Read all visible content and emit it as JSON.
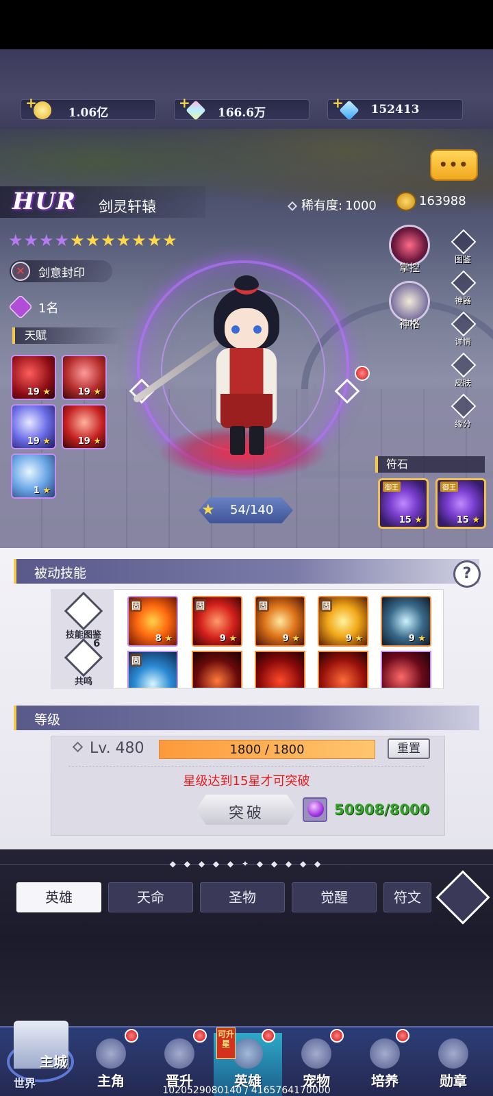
{
  "currencies": [
    {
      "value": "1.06亿",
      "icon": "gold-coin-icon"
    },
    {
      "value": "166.6万",
      "icon": "rainbow-crystal-icon"
    },
    {
      "value": "152413",
      "icon": "blue-diamond-icon"
    }
  ],
  "hero": {
    "grade": "HUR",
    "name": "剑灵轩辕",
    "rarity_label": "稀有度:",
    "rarity_value": "1000",
    "power": "163988",
    "stars": {
      "purple": 4,
      "gold": 7
    },
    "tag": "剑意封印",
    "rank": "1名",
    "xp": "54/140"
  },
  "talent": {
    "label": "天赋",
    "slots": [
      {
        "level": "19"
      },
      {
        "level": "19"
      },
      {
        "level": "19"
      },
      {
        "level": "19"
      },
      {
        "level": "1"
      }
    ]
  },
  "side_buttons": [
    {
      "label": "图鉴",
      "icon": "codex-icon"
    },
    {
      "label": "神器",
      "icon": "artifact-icon"
    },
    {
      "label": "详情",
      "icon": "details-icon"
    },
    {
      "label": "皮肤",
      "icon": "skin-icon"
    },
    {
      "label": "缘分",
      "icon": "bond-icon"
    }
  ],
  "round_buttons": [
    {
      "label": "掌控",
      "icon": "control-icon"
    },
    {
      "label": "神格",
      "icon": "divinity-icon"
    }
  ],
  "runes": {
    "label": "符石",
    "items": [
      {
        "tag": "御王",
        "level": "15"
      },
      {
        "tag": "御王",
        "level": "15"
      }
    ]
  },
  "passive": {
    "title": "被动技能",
    "side": [
      {
        "label": "技能图鉴",
        "count": ""
      },
      {
        "label": "共鸣",
        "count": "6"
      }
    ],
    "fixed_tag": "固",
    "skills_row1": [
      {
        "level": "8"
      },
      {
        "level": "9"
      },
      {
        "level": "9"
      },
      {
        "level": "9"
      },
      {
        "level": "9"
      }
    ]
  },
  "level": {
    "title": "等级",
    "lv": "Lv. 480",
    "progress": "1800 / 1800",
    "progress_fraction": 1.0,
    "reset": "重置",
    "requirement": "星级达到15星才可突破",
    "break_label": "突破",
    "cost": "50908/8000"
  },
  "tabs": [
    "英雄",
    "天命",
    "圣物",
    "觉醒",
    "符文"
  ],
  "nav": [
    {
      "label": "主角"
    },
    {
      "label": "晋升"
    },
    {
      "label": "英雄"
    },
    {
      "label": "宠物"
    },
    {
      "label": "培养"
    },
    {
      "label": "勋章"
    }
  ],
  "castle": {
    "label": "主城",
    "sub": "世界"
  },
  "upgrade_badge": "可升星",
  "debug_text": "1020529080140 / 4165764170000",
  "colors": {
    "accent_purple": "#b67bf2",
    "star_gold": "#ffd84a",
    "cost_green": "#37a22b",
    "warn_red": "#e01d1d"
  }
}
